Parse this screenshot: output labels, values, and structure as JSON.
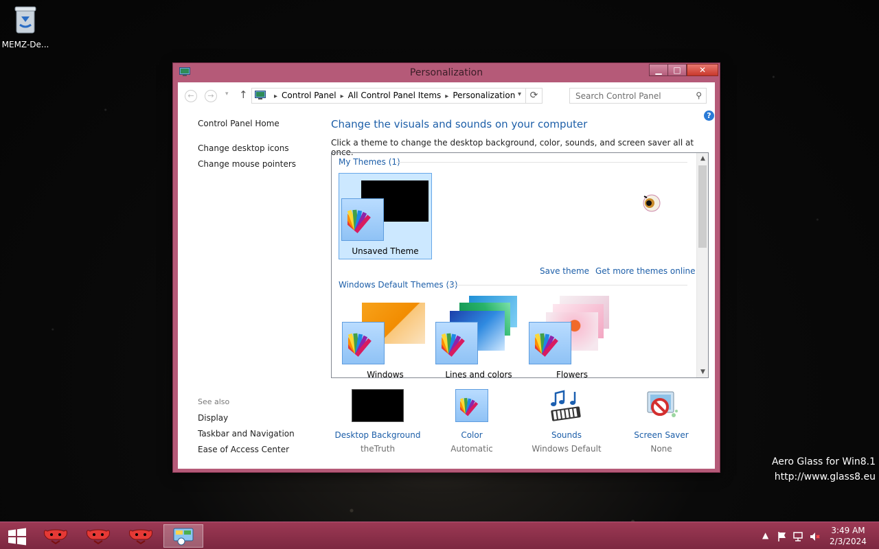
{
  "desktop": {
    "icon_label": "MEMZ-De...",
    "watermark_line1": "Aero Glass for Win8.1",
    "watermark_line2": "http://www.glass8.eu"
  },
  "window": {
    "title": "Personalization",
    "controls": {
      "minimize": "▁",
      "maximize": "□",
      "close": "✕"
    }
  },
  "navigation": {
    "back": "←",
    "forward": "→",
    "up": "↑",
    "breadcrumbs": [
      "Control Panel",
      "All Control Panel Items",
      "Personalization"
    ],
    "search_placeholder": "Search Control Panel"
  },
  "sidebar": {
    "links": [
      "Control Panel Home",
      "Change desktop icons",
      "Change mouse pointers"
    ],
    "see_also_label": "See also",
    "see_also": [
      "Display",
      "Taskbar and Navigation",
      "Ease of Access Center"
    ]
  },
  "main": {
    "title": "Change the visuals and sounds on your computer",
    "description": "Click a theme to change the desktop background, color, sounds, and screen saver all at once.",
    "my_themes_header": "My Themes (1)",
    "my_themes": [
      {
        "name": "Unsaved Theme",
        "selected": true
      }
    ],
    "save_theme": "Save theme",
    "get_more": "Get more themes online",
    "default_themes_header": "Windows Default Themes (3)",
    "default_themes": [
      {
        "name": "Windows"
      },
      {
        "name": "Lines and colors"
      },
      {
        "name": "Flowers"
      }
    ]
  },
  "bottom": [
    {
      "label": "Desktop Background",
      "value": "theTruth",
      "icon": "black-wallpaper-icon"
    },
    {
      "label": "Color",
      "value": "Automatic",
      "icon": "color-palette-icon"
    },
    {
      "label": "Sounds",
      "value": "Windows Default",
      "icon": "music-notes-icon"
    },
    {
      "label": "Screen Saver",
      "value": "None",
      "icon": "screen-saver-icon"
    }
  ],
  "taskbar": {
    "time": "3:49 AM",
    "date": "2/3/2024"
  },
  "colors": {
    "window_frame": "#b55a78",
    "link_blue": "#1c5ea8",
    "taskbar": "#8a3049",
    "selection": "#cce8ff"
  }
}
